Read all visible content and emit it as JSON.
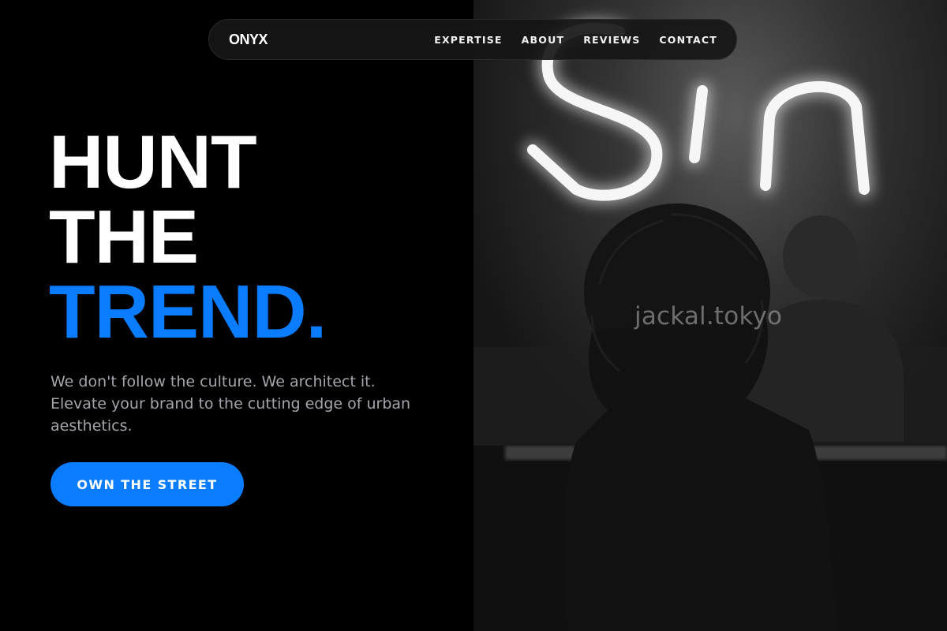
{
  "brand": {
    "logo": "ONYX"
  },
  "nav": {
    "links": [
      {
        "label": "EXPERTISE"
      },
      {
        "label": "ABOUT"
      },
      {
        "label": "REVIEWS"
      },
      {
        "label": "CONTACT"
      }
    ]
  },
  "hero": {
    "title_line1": "HUNT",
    "title_line2": "THE",
    "title_line3": "TREND.",
    "subtitle": "We don't follow the culture. We architect it. Elevate your brand to the cutting edge of urban aesthetics.",
    "cta_label": "OWN THE STREET"
  },
  "photo": {
    "neon_sign_text": "Sin",
    "watermark": "jackal.tokyo"
  },
  "colors": {
    "accent": "#0a7cff",
    "background": "#000000",
    "nav_background": "#161616",
    "subtitle_text": "#a5a5ad"
  }
}
